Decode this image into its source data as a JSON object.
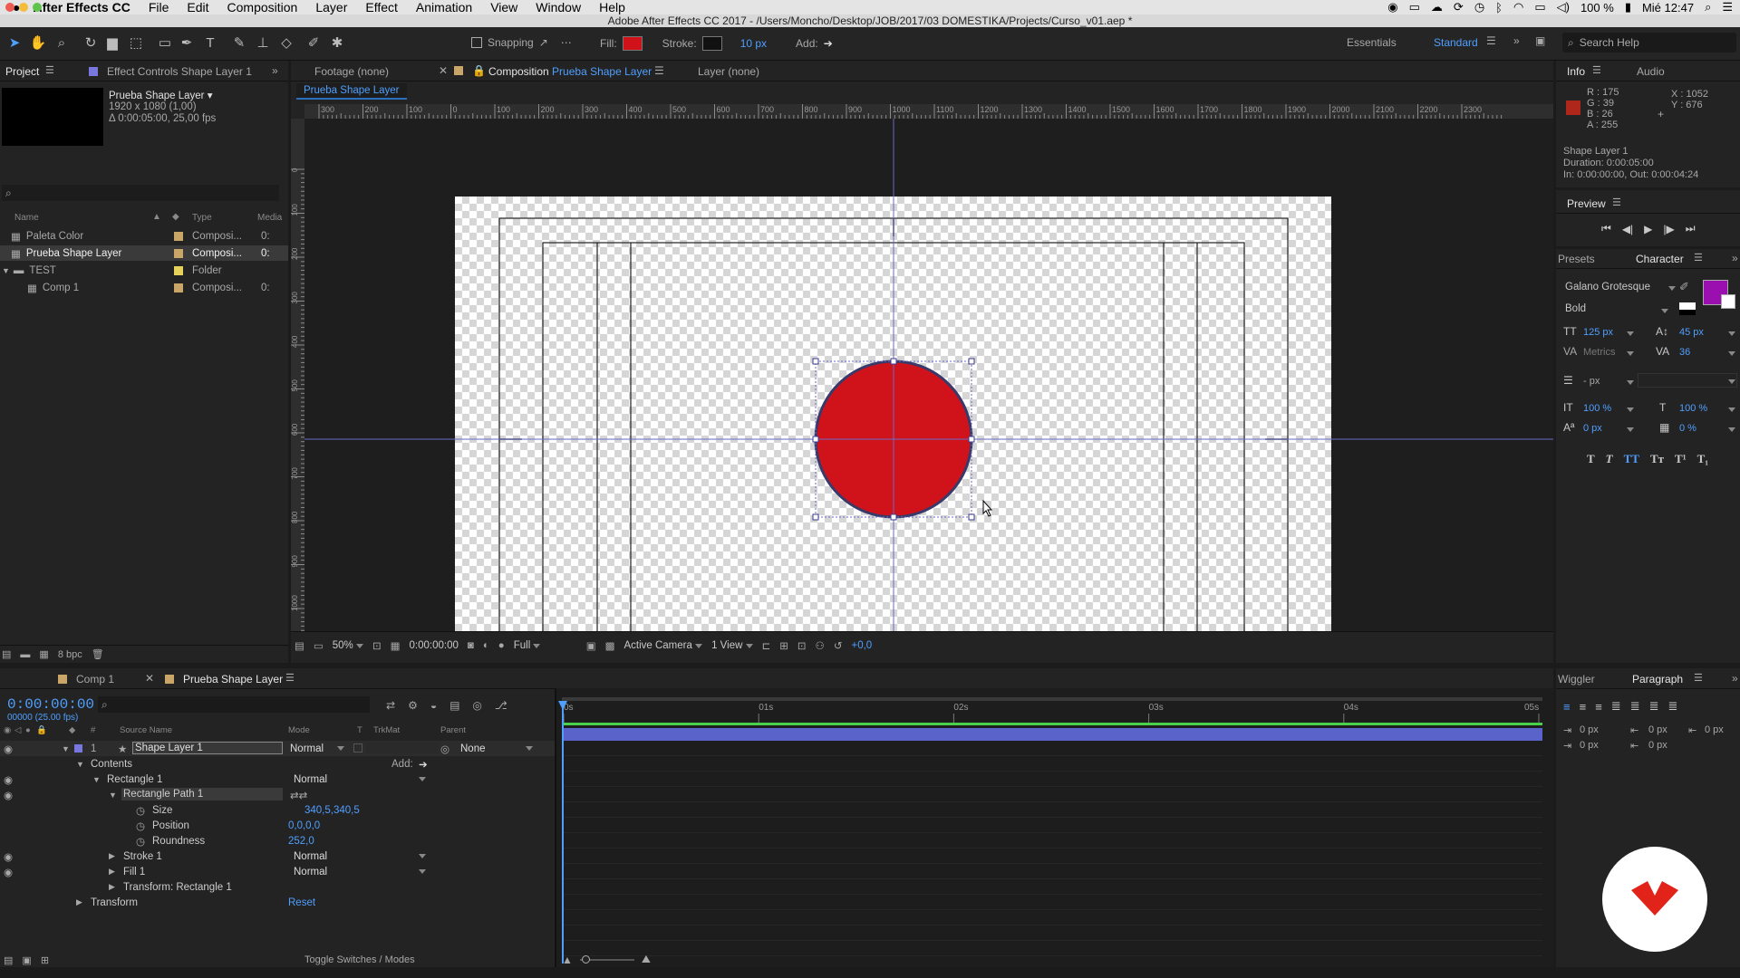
{
  "menubar": {
    "app": "After Effects CC",
    "items": [
      "File",
      "Edit",
      "Composition",
      "Layer",
      "Effect",
      "Animation",
      "View",
      "Window",
      "Help"
    ],
    "battery": "100 %",
    "clock": "Mié 12:47"
  },
  "window_title": "Adobe After Effects CC 2017 - /Users/Moncho/Desktop/JOB/2017/03 DOMESTIKA/Projects/Curso_v01.aep *",
  "toolbar": {
    "snapping": "Snapping",
    "fill": "Fill:",
    "stroke": "Stroke:",
    "stroke_width": "10 px",
    "add": "Add:",
    "workspace_essentials": "Essentials",
    "workspace_standard": "Standard",
    "search_placeholder": "Search Help",
    "fill_color": "#d0131a"
  },
  "project": {
    "tab": "Project",
    "effect_tab": "Effect Controls Shape Layer 1",
    "selected_name": "Prueba Shape Layer ▾",
    "selected_dims": "1920 x 1080 (1,00)",
    "selected_duration": "Δ 0:00:05:00, 25,00 fps",
    "search_placeholder": "",
    "columns": {
      "name": "Name",
      "type": "Type",
      "media": "Media"
    },
    "items": [
      {
        "name": "Paleta Color",
        "type": "Composi...",
        "media": "0:",
        "color": "#c9a668"
      },
      {
        "name": "Prueba Shape Layer",
        "type": "Composi...",
        "media": "0:",
        "color": "#c9a668"
      },
      {
        "name": "TEST",
        "type": "Folder",
        "media": "",
        "color": "#e6d25a"
      },
      {
        "name": "Comp 1",
        "type": "Composi...",
        "media": "0:",
        "color": "#c9a668"
      }
    ],
    "bpc": "8 bpc"
  },
  "viewer": {
    "tab_footage": "Footage (none)",
    "tab_comp_prefix": "Composition",
    "tab_comp_name": "Prueba Shape Layer",
    "tab_layer": "Layer (none)",
    "breadcrumb": "Prueba Shape Layer",
    "ruler_labels": [
      "300",
      "200",
      "100",
      "0",
      "100",
      "200",
      "300",
      "400",
      "500",
      "600",
      "700",
      "800",
      "900",
      "1000",
      "1100",
      "1200",
      "1300",
      "1400",
      "1500",
      "1600",
      "1700",
      "1800",
      "1900",
      "2000",
      "2100",
      "2200",
      "2300"
    ],
    "vruler_labels": [
      "0",
      "100",
      "200",
      "300",
      "400",
      "500",
      "600",
      "700",
      "800",
      "900",
      "1000"
    ],
    "zoom": "50%",
    "timecode": "0:00:00:00",
    "resolution": "Full",
    "camera": "Active Camera",
    "views": "1 View",
    "exposure": "+0,0"
  },
  "info": {
    "tab": "Info",
    "audio_tab": "Audio",
    "r": "R : 175",
    "g": "G : 39",
    "b": "B : 26",
    "a": "A : 255",
    "x": "X : 1052",
    "y": "Y : 676",
    "layer": "Shape Layer 1",
    "duration": "Duration: 0:00:05:00",
    "inout": "In: 0:00:00:00, Out: 0:00:04:24",
    "color": "#af271a"
  },
  "preview": {
    "title": "Preview"
  },
  "character": {
    "presets_tab": "Presets",
    "tab": "Character",
    "font": "Galano Grotesque",
    "style": "Bold",
    "size": "125 px",
    "leading": "45 px",
    "kerning": "Metrics",
    "tracking": "36",
    "stroke_width": "- px",
    "vscale": "100 %",
    "hscale": "100 %",
    "baseline": "0 px",
    "tsume": "0 %",
    "fill_color": "#9b0fb0"
  },
  "paragraph": {
    "wiggler_tab": "Wiggler",
    "tab": "Paragraph",
    "indent_left": "0 px",
    "indent_first": "0 px",
    "indent_right": "0 px",
    "space_before": "0 px",
    "space_after": "0 px"
  },
  "timeline": {
    "tab_comp1": "Comp 1",
    "tab_active": "Prueba Shape Layer",
    "timecode": "0:00:00:00",
    "frames": "00000 (25.00 fps)",
    "columns": {
      "num": "#",
      "source": "Source Name",
      "mode": "Mode",
      "t": "T",
      "trkmat": "TrkMat",
      "parent": "Parent"
    },
    "layer": {
      "num": "1",
      "name": "Shape Layer 1",
      "mode": "Normal",
      "parent": "None"
    },
    "contents": "Contents",
    "add": "Add:",
    "rect1": "Rectangle 1",
    "rect1_mode": "Normal",
    "path1": "Rectangle Path 1",
    "size_label": "Size",
    "size_value": "340,5,340,5",
    "pos_label": "Position",
    "pos_value": "0,0,0,0",
    "round_label": "Roundness",
    "round_value": "252,0",
    "stroke1": "Stroke 1",
    "stroke1_mode": "Normal",
    "fill1": "Fill 1",
    "fill1_mode": "Normal",
    "transform_rect": "Transform: Rectangle 1",
    "transform": "Transform",
    "reset": "Reset",
    "ruler": [
      "0s",
      "01s",
      "02s",
      "03s",
      "04s",
      "05s"
    ],
    "toggle": "Toggle Switches / Modes"
  }
}
